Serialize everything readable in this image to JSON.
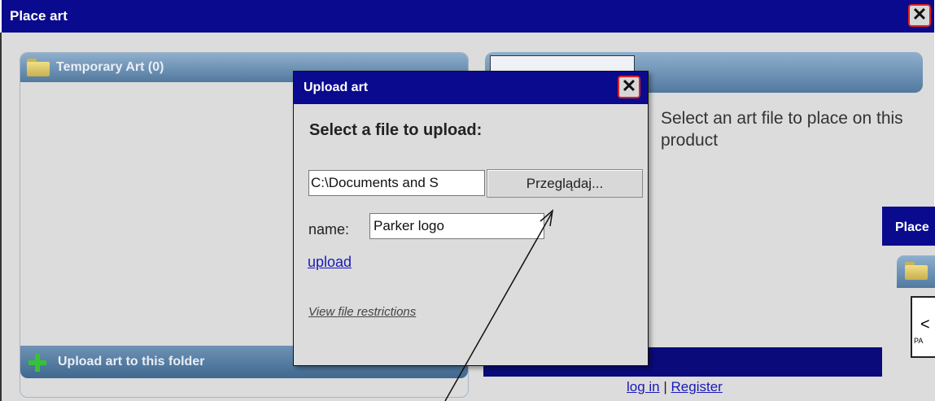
{
  "main_window": {
    "title": "Place art",
    "close_glyph": "✕",
    "left_panel": {
      "folder_label": "Temporary Art (0)",
      "footer_label": "Upload art to this folder",
      "folder_icon": "folder-icon",
      "add_icon": "plus-icon"
    },
    "right_panel": {
      "message": "Select an art file to place on this product",
      "login_link": "log in",
      "separator": "|",
      "register_link": "Register"
    }
  },
  "upload_dialog": {
    "title": "Upload art",
    "close_glyph": "✕",
    "heading": "Select a file to upload:",
    "file_path_value": "C:\\Documents and S",
    "browse_button": "Przeglądaj...",
    "name_label": "name:",
    "name_value": "Parker logo",
    "upload_link": "upload",
    "restrictions_link": "View file restrictions"
  },
  "background_window": {
    "title": "Place",
    "thumb_symbol": "<",
    "thumb_text": "PA"
  },
  "colors": {
    "titlebar": "#0a0a8e",
    "panel_header": "#52799f",
    "link": "#1a1ab8",
    "close_border": "#e02020",
    "plus": "#36c236"
  }
}
